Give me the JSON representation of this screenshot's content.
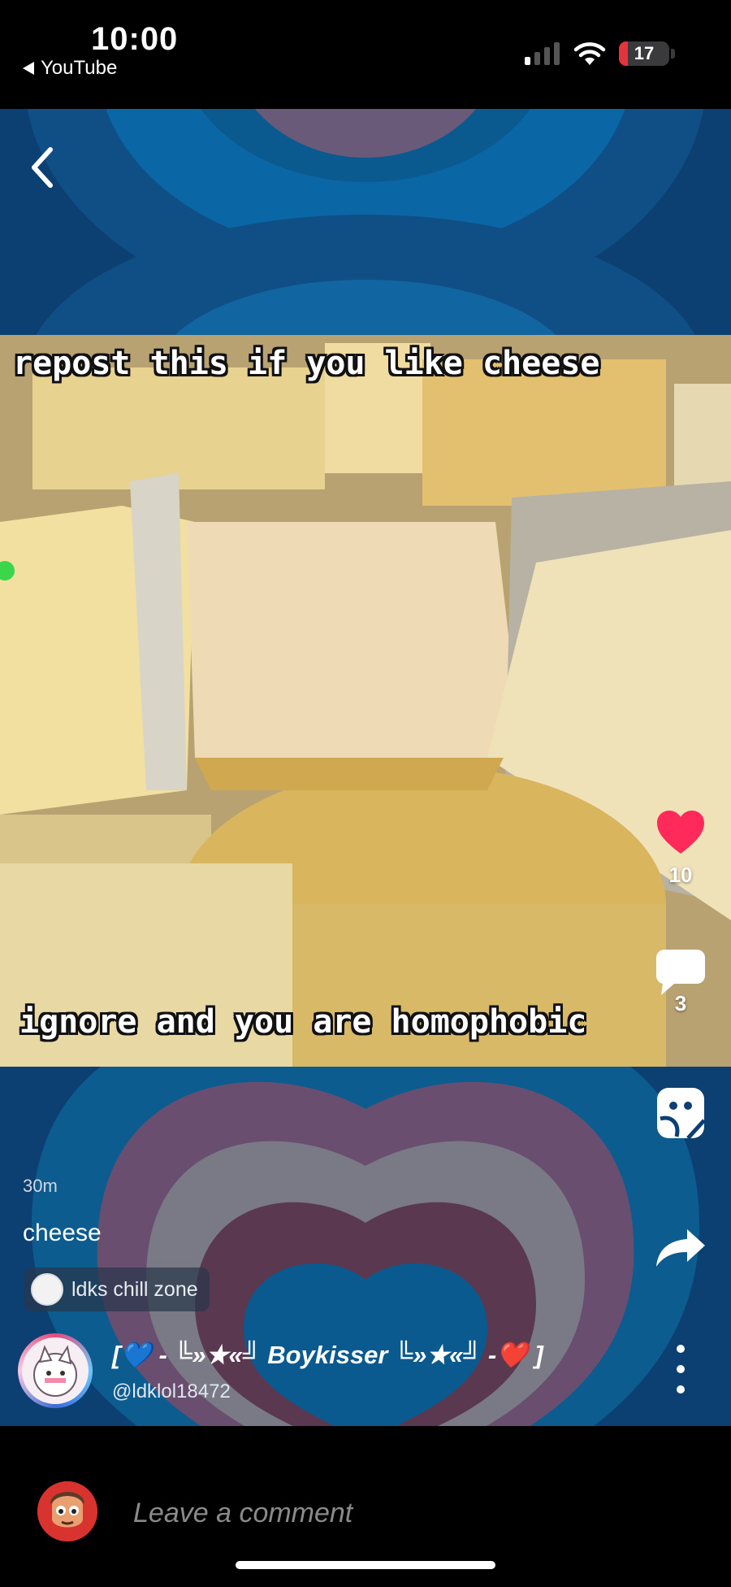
{
  "status_bar": {
    "time": "10:00",
    "back_app": "YouTube",
    "battery": "17",
    "battery_level": 0.17
  },
  "post": {
    "video_caption_top": "repost this if you like cheese",
    "video_caption_bottom": "ignore and you are homophobic",
    "time_ago": "30m",
    "title": "cheese",
    "community": "ldks chill zone",
    "author": {
      "name": "[💙 - ╚»★«╝ Boykisser ╚»★«╝ -❤️ ]",
      "handle": "@ldklol18472"
    }
  },
  "actions": {
    "likes": "10",
    "comments": "3",
    "like_color": "#ff2a5a"
  },
  "comment_bar": {
    "placeholder": "Leave a comment"
  },
  "icons": [
    "back-arrow-icon",
    "heart-icon",
    "comment-icon",
    "sticker-icon",
    "share-icon",
    "more-icon",
    "wifi-icon",
    "signal-icon",
    "battery-icon"
  ]
}
